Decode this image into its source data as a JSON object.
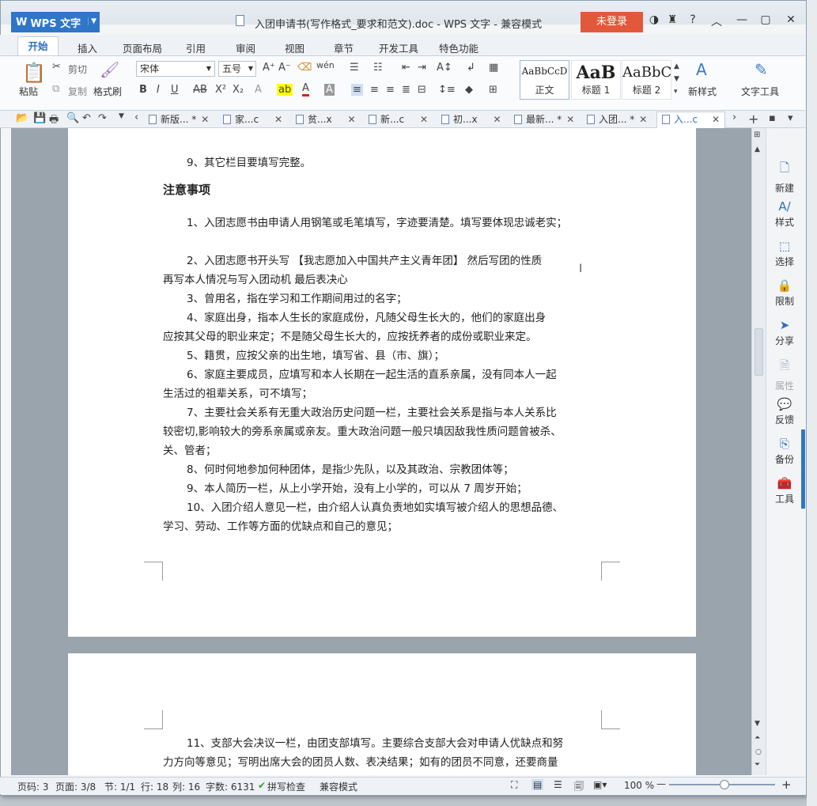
{
  "window": {
    "app_name": "WPS 文字",
    "title": "入团申请书(写作格式_要求和范文).doc - WPS 文字 - 兼容模式",
    "login_button": "未登录"
  },
  "menu": [
    "开始",
    "插入",
    "页面布局",
    "引用",
    "审阅",
    "视图",
    "章节",
    "开发工具",
    "特色功能"
  ],
  "ribbon": {
    "paste": "粘贴",
    "cut": "剪切",
    "copy": "复制",
    "format_painter": "格式刷",
    "font": "宋体",
    "size": "五号",
    "styles": [
      {
        "preview": "AaBbCcD",
        "name": "正文"
      },
      {
        "preview": "AaB",
        "name": "标题 1"
      },
      {
        "preview": "AaBbC",
        "name": "标题 2"
      }
    ],
    "new_style": "新样式",
    "text_tools": "文字工具"
  },
  "doc_tabs": [
    "新版... *",
    "家...c",
    "贫...x",
    "新...c",
    "初...x",
    "最新... *",
    "入团... *",
    "入...c"
  ],
  "document": {
    "page1_lines": [
      "9、其它栏目要填写完整。",
      "注意事项",
      "1、入团志愿书由申请人用钢笔或毛笔填写，字迹要清楚。填写要体现忠诚老实；",
      "2、入团志愿书开头写 【我志愿加入中国共产主义青年团】 然后写团的性质",
      "再写本人情况与写入团动机  最后表决心",
      "3、曾用名，指在学习和工作期间用过的名字；",
      "4、家庭出身，指本人生长的家庭成份，凡随父母生长大的，他们的家庭出身",
      "应按其父母的职业来定；不是随父母生长大的，应按抚养者的成份或职业来定。",
      "5、籍贯，应按父亲的出生地，填写省、县（市、旗）；",
      "6、家庭主要成员，应填写和本人长期在一起生活的直系亲属，没有同本人一起",
      "生活过的祖辈关系，可不填写；",
      "7、主要社会关系有无重大政治历史问题一栏，主要社会关系是指与本人关系比",
      "较密切,影响较大的旁系亲属或亲友。重大政治问题一般只填因敌我性质问题曾被杀、",
      "关、管者；",
      "8、何时何地参加何种团体，是指少先队，以及其政治、宗教团体等；",
      "9、本人简历一栏，从上小学开始，没有上小学的，可以从 7 周岁开始；",
      "10、入团介绍人意见一栏，由介绍人认真负责地如实填写被介绍人的思想品德、",
      "学习、劳动、工作等方面的优缺点和自己的意见；"
    ],
    "page2_lines": [
      "11、支部大会决议一栏，由团支部填写。主要综合支部大会对申请人优缺点和努",
      "力方向等意见；写明出席大会的团员人数、表决结果；如有的团员不同意，还要商量"
    ]
  },
  "right_panel": [
    "新建",
    "样式",
    "选择",
    "限制",
    "分享",
    "属性",
    "反馈",
    "备份",
    "工具"
  ],
  "status": {
    "page_num": "页码: 3",
    "pages": "页面: 3/8",
    "section": "节: 1/1",
    "row": "行: 18",
    "col": "列: 16",
    "words": "字数: 6131",
    "spell": "拼写检查",
    "mode": "兼容模式",
    "zoom": "100 %"
  },
  "colors": {
    "accent": "#2f75c8",
    "login": "#e1583a"
  }
}
